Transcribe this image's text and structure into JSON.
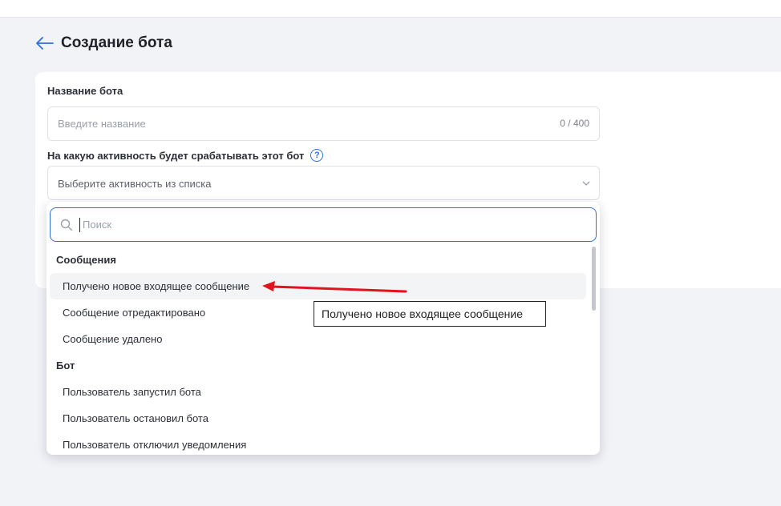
{
  "header": {
    "title": "Создание бота"
  },
  "form": {
    "name_label": "Название бота",
    "name_placeholder": "Введите название",
    "name_counter": "0 / 400",
    "activity_label": "На какую активность будет срабатывать этот бот",
    "help_icon": "?",
    "activity_placeholder": "Выберите активность из списка"
  },
  "dropdown": {
    "search_placeholder": "Поиск",
    "groups": [
      {
        "title": "Сообщения",
        "options": [
          "Получено новое входящее сообщение",
          "Сообщение отредактировано",
          "Сообщение удалено"
        ]
      },
      {
        "title": "Бот",
        "options": [
          "Пользователь запустил бота",
          "Пользователь остановил бота",
          "Пользователь отключил уведомления"
        ]
      }
    ]
  },
  "tooltip": {
    "text": "Получено новое входящее сообщение"
  },
  "colors": {
    "accent": "#2e6fdc",
    "annotation_arrow": "#e0141e",
    "background": "#f2f3f7"
  }
}
